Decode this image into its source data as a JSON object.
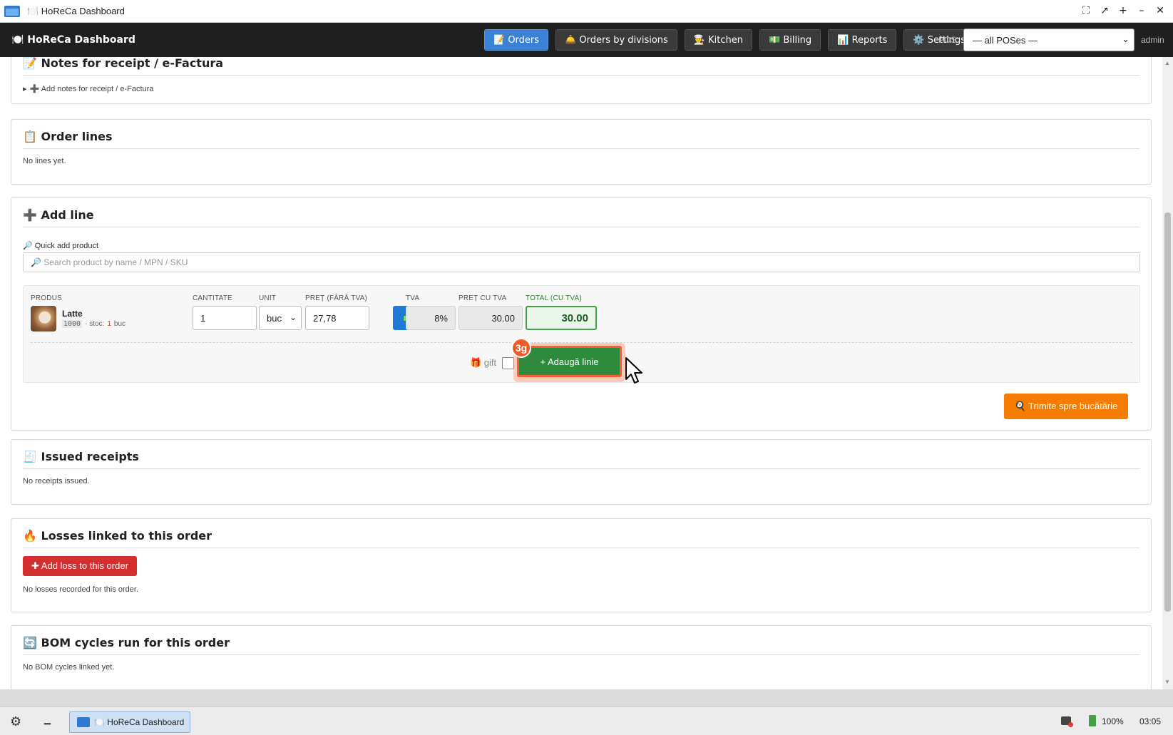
{
  "window": {
    "title": "🍽️ HoReCa Dashboard",
    "controls": [
      "⛶",
      "↗",
      "+",
      "–",
      "✕"
    ]
  },
  "nav": {
    "brand": "🍽️ HoReCa Dashboard",
    "buttons": [
      {
        "label": "📝 Orders",
        "active": true
      },
      {
        "label": "🛎️ Orders by divisions",
        "active": false
      },
      {
        "label": "👨‍🍳 Kitchen",
        "active": false
      },
      {
        "label": "💵 Billing",
        "active": false
      },
      {
        "label": "📊 Reports",
        "active": false
      },
      {
        "label": "⚙️ Settings",
        "active": false
      }
    ],
    "pos_label": "POS:",
    "pos_value": "— all POSes —",
    "user": "admin"
  },
  "notes": {
    "title": "📝 Notes for receipt / e-Factura",
    "summary": "➕ Add notes for receipt / e-Factura"
  },
  "order_lines": {
    "title": "📋 Order lines",
    "empty": "No lines yet."
  },
  "add_line": {
    "title": "➕ Add line",
    "quick_label": "🔎 Quick add product",
    "search_placeholder": "🔎 Search product by name / MPN / SKU",
    "columns": {
      "product": "PRODUS",
      "qty": "CANTITATE",
      "unit": "UNIT",
      "price_net": "PREȚ (FĂRĂ TVA)",
      "vat": "TVA",
      "price_gross": "PREȚ CU TVA",
      "total": "TOTAL (CU TVA)"
    },
    "product": {
      "name": "Latte",
      "code": "1000",
      "stock_label": "· stoc:",
      "stock_value": "1",
      "stock_unit": "buc"
    },
    "qty": "1",
    "unit": "buc",
    "price_net": "27,78",
    "vat": "8%",
    "price_gross": "30.00",
    "total": "30.00",
    "gift_label": "🎁 gift",
    "gift_checked": false,
    "add_button": "+ Adaugă linie",
    "step_badge": "3g",
    "kitchen_button": "🍳 Trimite spre bucătărie"
  },
  "receipts": {
    "title": "🧾 Issued receipts",
    "empty": "No receipts issued."
  },
  "losses": {
    "title": "🔥 Losses linked to this order",
    "button": "✚ Add loss to this order",
    "empty": "No losses recorded for this order."
  },
  "bom": {
    "title": "🔄 BOM cycles run for this order",
    "empty": "No BOM cycles linked yet."
  },
  "taskbar": {
    "task": "🍽️ HoReCa Dashboard",
    "battery": "100%",
    "time": "03:05"
  },
  "colors": {
    "accent": "#3b82d6",
    "success": "#2e8b3e",
    "warning": "#f57c00",
    "danger": "#d32f2f",
    "highlight": "#ff5a36"
  }
}
